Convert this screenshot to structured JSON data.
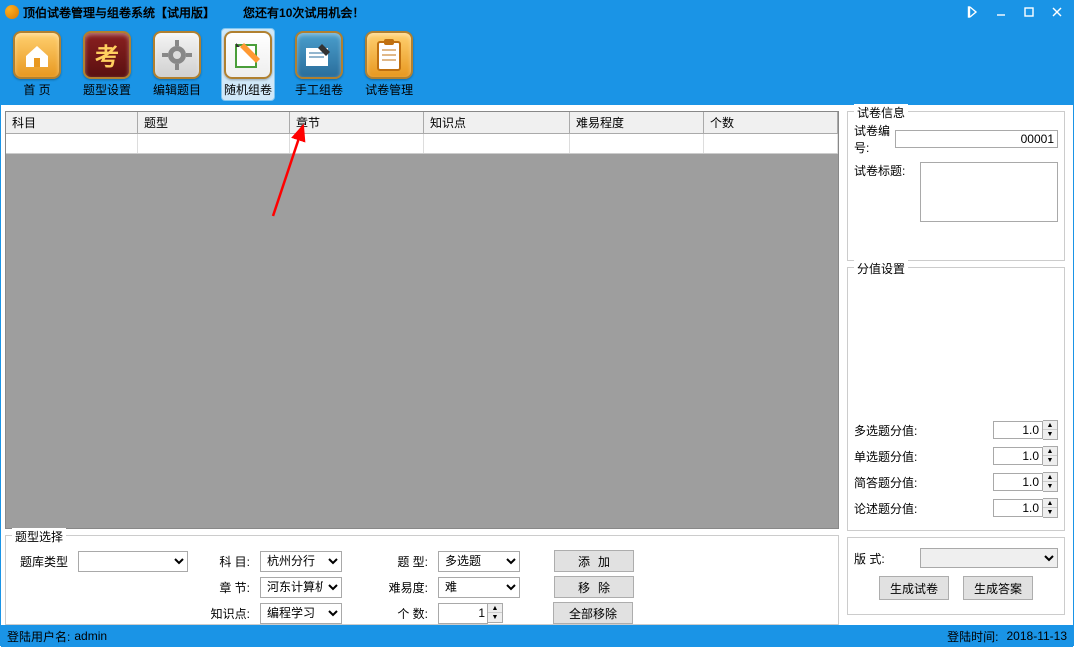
{
  "titlebar": {
    "app_title": "顶伯试卷管理与组卷系统【试用版】",
    "trial_notice": "您还有10次试用机会！"
  },
  "toolbar": {
    "home": "首 页",
    "type_settings": "题型设置",
    "edit_questions": "编辑题目",
    "random_compose": "随机组卷",
    "manual_compose": "手工组卷",
    "paper_manage": "试卷管理"
  },
  "grid_headers": {
    "subject": "科目",
    "type": "题型",
    "chapter": "章节",
    "knowledge": "知识点",
    "difficulty": "难易程度",
    "count": "个数"
  },
  "selection": {
    "legend": "题型选择",
    "label_bank_type": "题库类型",
    "label_subject": "科 目:",
    "subject_value": "杭州分行",
    "label_type": "题  型:",
    "type_value": "多选题",
    "btn_add": "添加",
    "label_chapter": "章  节:",
    "chapter_value": "河东计算机考",
    "label_difficulty": "难易度:",
    "difficulty_value": "难",
    "btn_remove": "移除",
    "label_knowledge": "知识点:",
    "knowledge_value": "编程学习",
    "label_count": "个  数:",
    "count_value": "1",
    "btn_remove_all": "全部移除"
  },
  "paper_info": {
    "legend": "试卷信息",
    "label_paper_no": "试卷编号:",
    "paper_no_value": "00001",
    "label_paper_title": "试卷标题:"
  },
  "score": {
    "legend": "分值设置",
    "label_multi": "多选题分值:",
    "label_single": "单选题分值:",
    "label_short": "简答题分值:",
    "label_essay": "论述题分值:",
    "value_multi": "1.0",
    "value_single": "1.0",
    "value_short": "1.0",
    "value_essay": "1.0"
  },
  "format": {
    "label_format": "版   式:",
    "btn_gen_paper": "生成试卷",
    "btn_gen_answer": "生成答案"
  },
  "statusbar": {
    "login_user_label": "登陆用户名:",
    "login_user": "admin",
    "login_time_label": "登陆时间:",
    "login_time": "2018-11-13"
  }
}
